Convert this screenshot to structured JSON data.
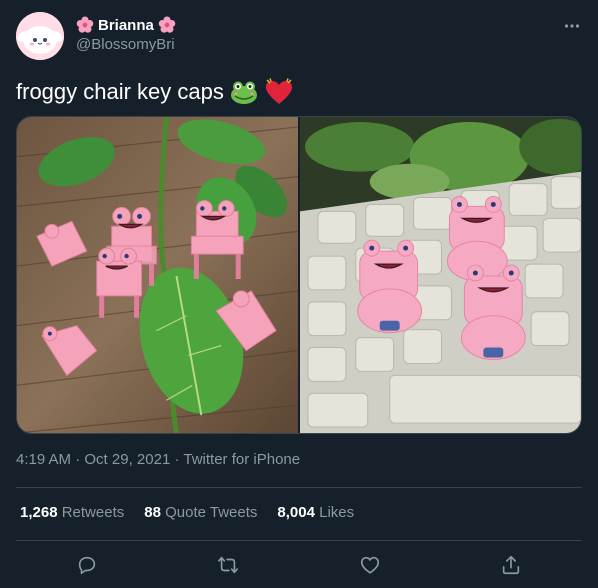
{
  "author": {
    "name": "Brianna",
    "name_prefix_emoji": "🌸",
    "name_suffix_emoji": "🌸",
    "handle": "@BlossomyBri",
    "avatar_icon": "cinnamoroll-avatar"
  },
  "tweet": {
    "text": "froggy chair key caps",
    "emoji": [
      "frog-face-emoji",
      "beating-heart-emoji"
    ]
  },
  "media": [
    {
      "icon": "frog-chair-keycaps-on-leaves-photo"
    },
    {
      "icon": "frog-keycaps-on-keyboard-photo"
    }
  ],
  "meta": {
    "time": "4:19 AM",
    "date": "Oct 29, 2021",
    "source": "Twitter for iPhone",
    "separator": "·"
  },
  "stats": {
    "retweets_count": "1,268",
    "retweets_label": "Retweets",
    "quotes_count": "88",
    "quotes_label": "Quote Tweets",
    "likes_count": "8,004",
    "likes_label": "Likes"
  },
  "actions": [
    "reply-icon",
    "retweet-icon",
    "like-icon",
    "share-icon"
  ],
  "colors": {
    "background": "#15202b",
    "text": "#ffffff",
    "muted": "#8b98a5",
    "border": "#38444d"
  }
}
